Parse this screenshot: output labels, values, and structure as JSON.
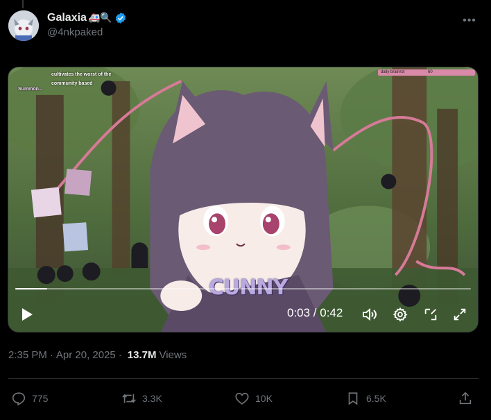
{
  "author": {
    "display_name": "Galaxia",
    "emoji": "🚑🔍",
    "handle": "@4nkpaked",
    "verified": true
  },
  "video": {
    "overlay_chat": "cultivates the worst of the community based",
    "overlay_summon": "Summon...",
    "overlay_bar_label": "daily brainrot",
    "overlay_bar_value": "60",
    "caption_text": "CUNNY",
    "time_display": "0:03 / 0:42",
    "progress": 0.07
  },
  "meta": {
    "time": "2:35 PM",
    "date": "Apr 20, 2025",
    "views_count": "13.7M",
    "views_label": "Views"
  },
  "actions": {
    "replies": "775",
    "reposts": "3.3K",
    "likes": "10K",
    "bookmarks": "6.5K"
  },
  "colors": {
    "background": "#000000",
    "text_primary": "#e7e9ea",
    "text_secondary": "#71767b",
    "verified_blue": "#1d9bf0",
    "divider": "#2f3336"
  }
}
